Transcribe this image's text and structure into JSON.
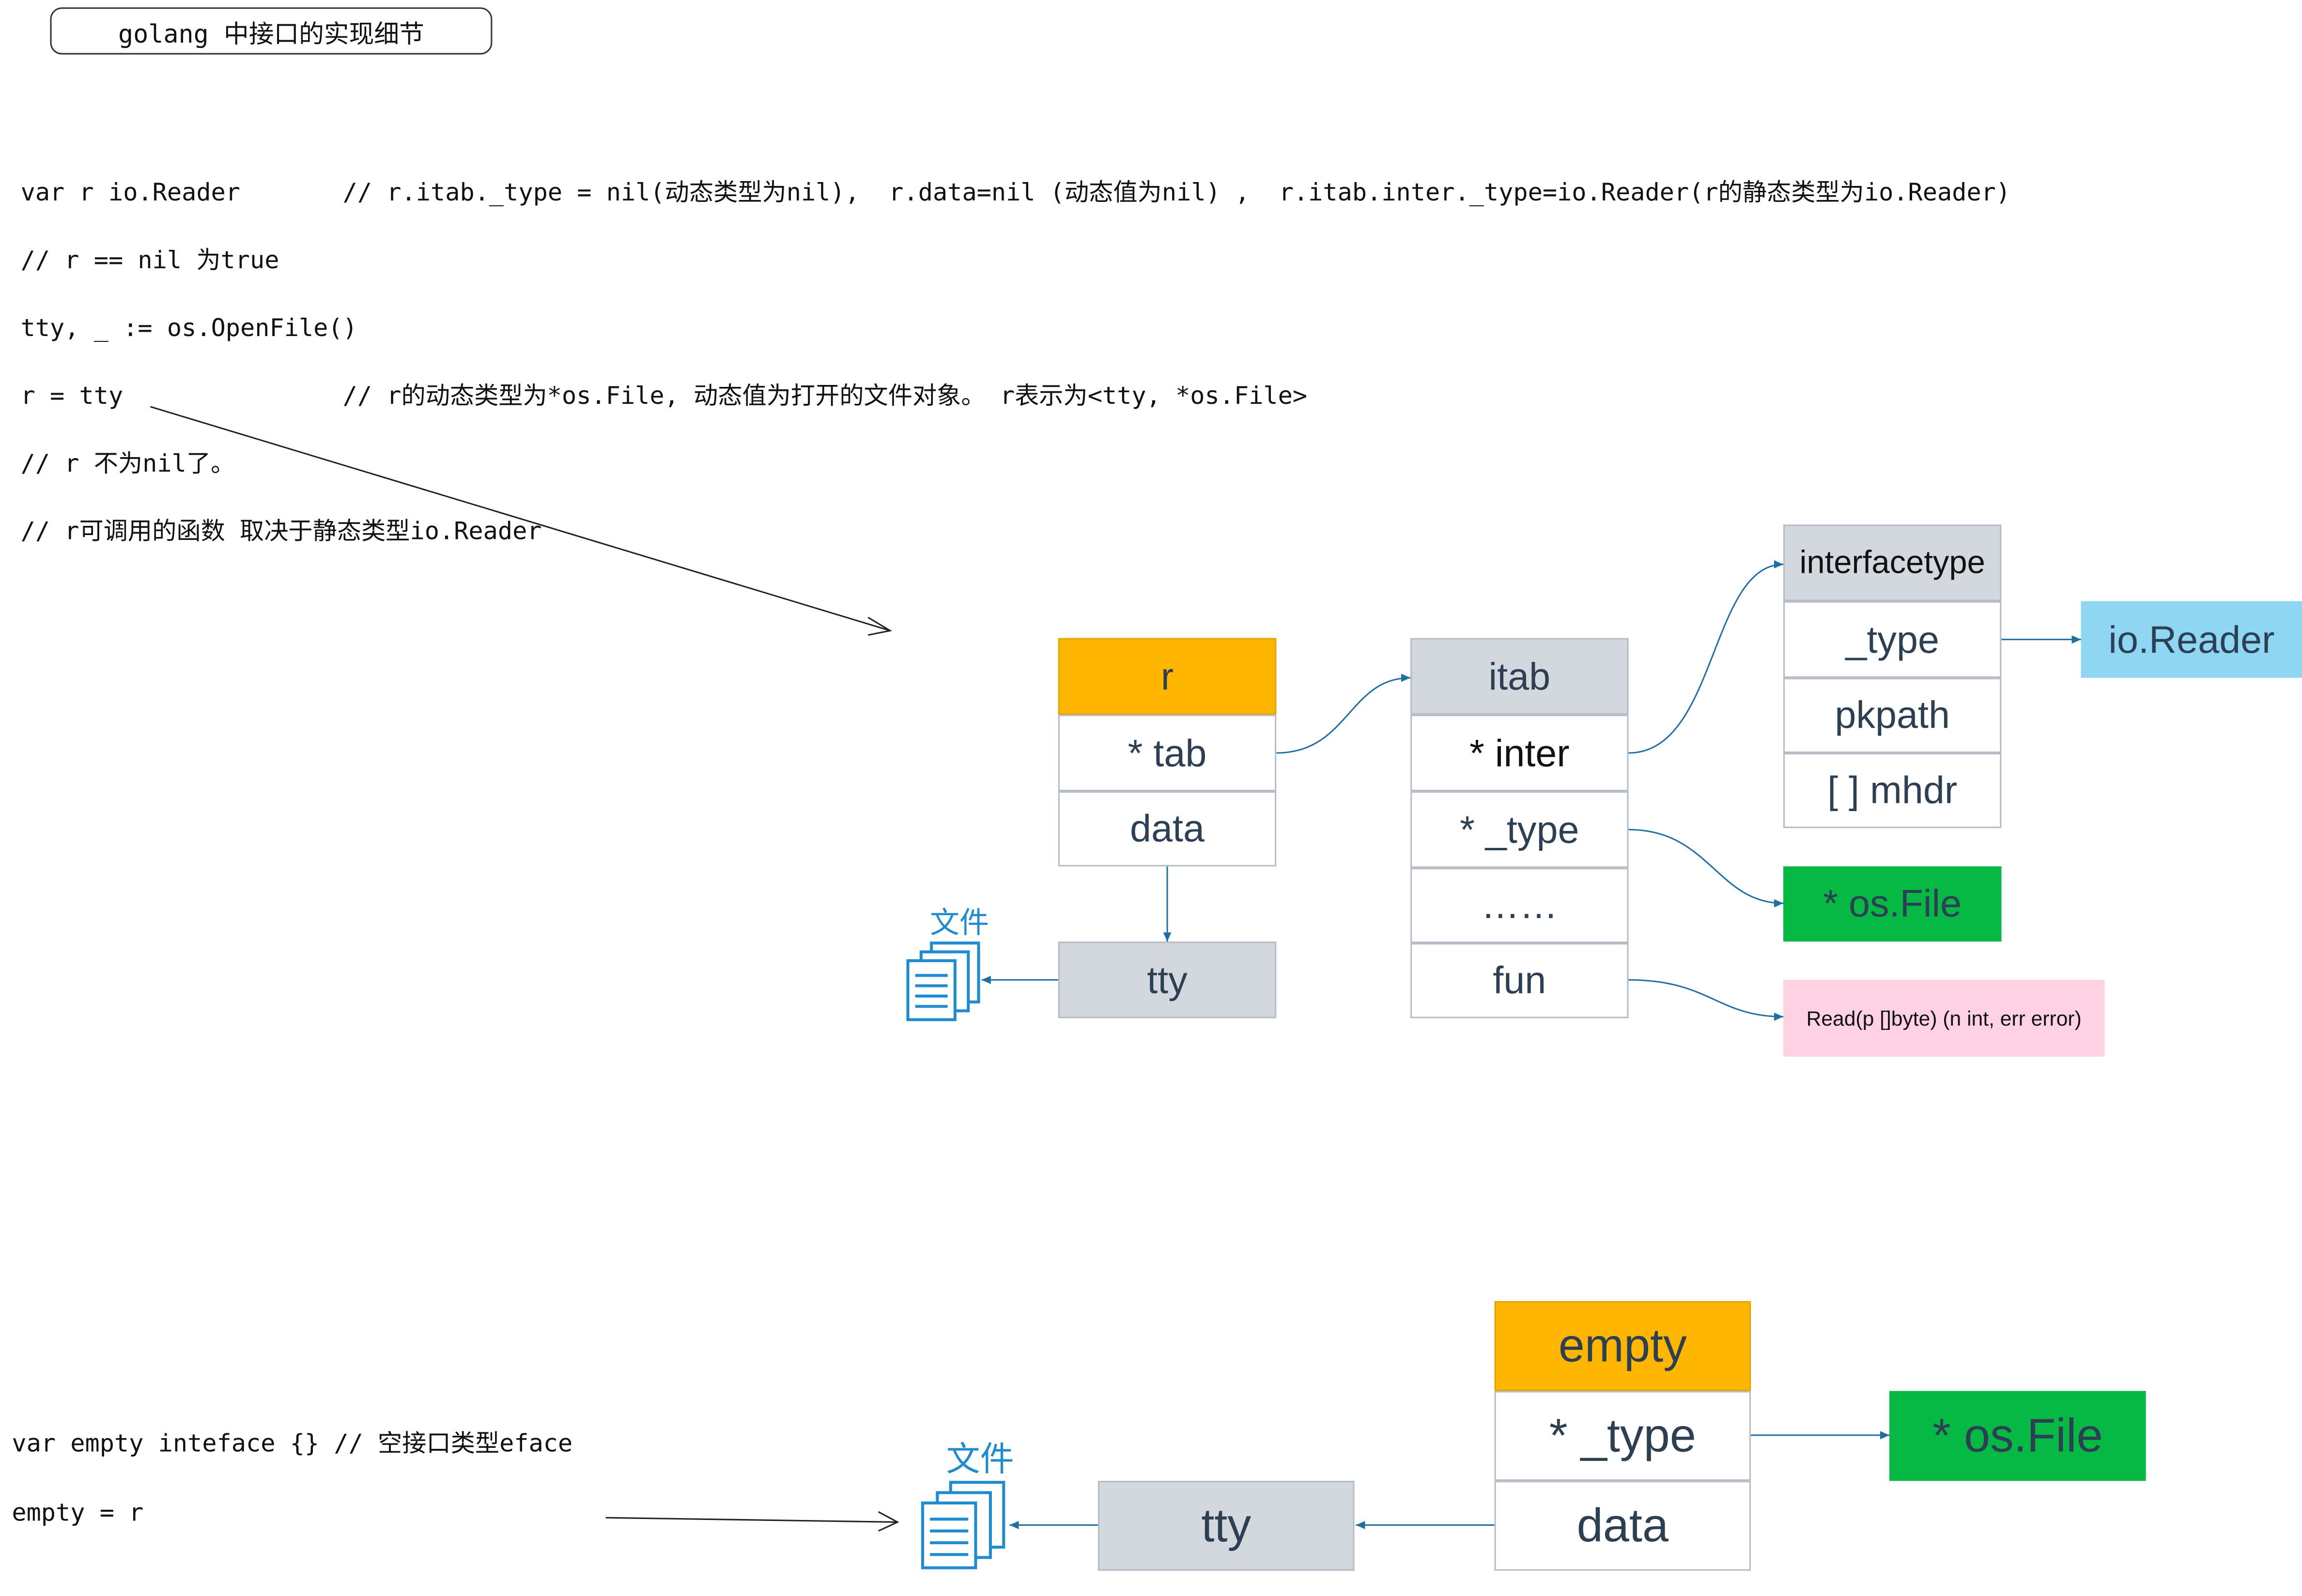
{
  "title": "golang 中接口的实现细节",
  "code_top": [
    "var r io.Reader       // r.itab._type = nil(动态类型为nil),  r.data=nil (动态值为nil) ,  r.itab.inter._type=io.Reader(r的静态类型为io.Reader)",
    "// r == nil 为true",
    "tty, _ := os.OpenFile()",
    "r = tty               // r的动态类型为*os.File, 动态值为打开的文件对象。 r表示为<tty, *os.File>",
    "// r 不为nil了。",
    "// r可调用的函数 取决于静态类型io.Reader"
  ],
  "code_bottom": [
    "var empty inteface {} // 空接口类型eface",
    "empty = r"
  ],
  "iface": {
    "header": "r",
    "fields": [
      "* tab",
      "data"
    ],
    "data_target": "tty",
    "file_label": "文件"
  },
  "itab": {
    "header": "itab",
    "fields": [
      "* inter",
      "* _type",
      "……",
      "fun"
    ]
  },
  "interfacetype": {
    "header": "interfacetype",
    "fields": [
      "_type",
      "pkpath",
      "[ ] mhdr"
    ]
  },
  "targets": {
    "io_reader": "io.Reader",
    "os_file": "* os.File",
    "read_func": "Read(p []byte) (n int, err error)"
  },
  "eface": {
    "header": "empty",
    "fields": [
      "* _type",
      "data"
    ],
    "type_target": "* os.File",
    "data_target": "tty",
    "file_label": "文件"
  },
  "colors": {
    "header_orange": "#FFB600",
    "gray_cell": "#d3d8de",
    "green": "#06b844",
    "light_blue": "#8fd6f2",
    "pink": "#ffd2e3",
    "arrow": "#1f6fa3",
    "file_icon": "#1f8bd1"
  }
}
